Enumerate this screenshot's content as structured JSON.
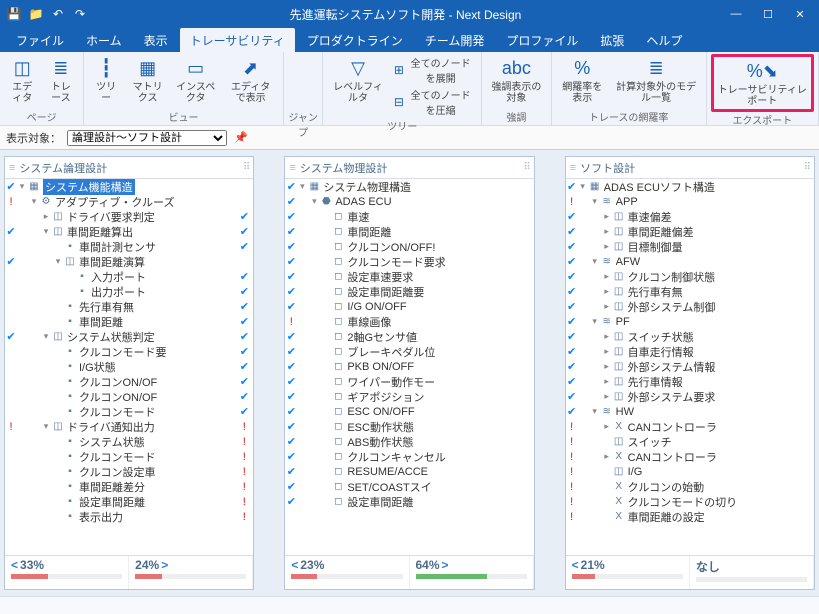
{
  "title": "先進運転システムソフト開発 - Next Design",
  "menu": [
    "ファイル",
    "ホーム",
    "表示",
    "トレーサビリティ",
    "プロダクトライン",
    "チーム開発",
    "プロファイル",
    "拡張",
    "ヘルプ"
  ],
  "menu_active": 3,
  "ribbon": {
    "groups": [
      {
        "label": "ページ",
        "items": [
          {
            "icon": "◫",
            "label": "エディタ"
          },
          {
            "icon": "≣",
            "label": "トレース"
          }
        ]
      },
      {
        "label": "ビュー",
        "items": [
          {
            "icon": "┇",
            "label": "ツリー"
          },
          {
            "icon": "▦",
            "label": "マトリクス"
          },
          {
            "icon": "▭",
            "label": "インスペクタ"
          },
          {
            "icon": "⬈",
            "label": "エディタで表示"
          }
        ]
      },
      {
        "label": "ジャンプ",
        "items": []
      },
      {
        "label": "ツリー",
        "items": [
          {
            "icon": "▽",
            "label": "レベルフィルタ"
          }
        ],
        "side": [
          {
            "icon": "⊞",
            "label": "全てのノードを展開"
          },
          {
            "icon": "⊟",
            "label": "全てのノードを圧縮"
          }
        ]
      },
      {
        "label": "強調",
        "items": [
          {
            "icon": "abc",
            "label": "強調表示の対象"
          }
        ]
      },
      {
        "label": "トレースの網羅率",
        "items": [
          {
            "icon": "%",
            "label": "網羅率を表示"
          },
          {
            "icon": "≣",
            "label": "計算対象外のモデル一覧"
          }
        ]
      },
      {
        "label": "エクスポート",
        "items": [
          {
            "icon": "%⬊",
            "label": "トレーサビリティレポート",
            "hl": true
          }
        ]
      }
    ]
  },
  "filter": {
    "label": "表示対象：",
    "value": "論理設計～ソフト設計"
  },
  "panes": [
    {
      "title": "システム論理設計",
      "coverage": [
        {
          "arrowL": "<",
          "pct": "33%",
          "fill": 33,
          "color": "red"
        },
        {
          "pct": "24%",
          "arrowR": ">",
          "fill": 24,
          "color": "red"
        }
      ],
      "nodes": [
        {
          "ind": 0,
          "m": "b",
          "t": "▾",
          "i": "▦",
          "l": "システム機能構造",
          "sel": true
        },
        {
          "ind": 1,
          "m": "r",
          "t": "▾",
          "i": "⚙",
          "l": "アダプティブ・クルーズ"
        },
        {
          "ind": 2,
          "t": "▸",
          "i": "◫",
          "l": "ドライバ要求判定",
          "r": "b"
        },
        {
          "ind": 2,
          "m": "b",
          "t": "▾",
          "i": "◫",
          "l": "車間距離算出",
          "r": "b"
        },
        {
          "ind": 3,
          "i": "▪",
          "l": "車間計測センサ",
          "r": "b"
        },
        {
          "ind": 3,
          "m": "b",
          "t": "▾",
          "i": "◫",
          "l": "車間距離演算"
        },
        {
          "ind": 4,
          "i": "▪",
          "l": "入力ポート",
          "r": "b"
        },
        {
          "ind": 4,
          "i": "▪",
          "l": "出力ポート",
          "r": "b"
        },
        {
          "ind": 3,
          "i": "▪",
          "l": "先行車有無",
          "r": "b"
        },
        {
          "ind": 3,
          "i": "▪",
          "l": "車間距離",
          "r": "b"
        },
        {
          "ind": 2,
          "m": "b",
          "t": "▾",
          "i": "◫",
          "l": "システム状態判定",
          "r": "b"
        },
        {
          "ind": 3,
          "i": "▪",
          "l": "クルコンモード要",
          "r": "b"
        },
        {
          "ind": 3,
          "i": "▪",
          "l": "I/G状態",
          "r": "b"
        },
        {
          "ind": 3,
          "i": "▪",
          "l": "クルコンON/OF",
          "r": "b"
        },
        {
          "ind": 3,
          "i": "▪",
          "l": "クルコンON/OF",
          "r": "b"
        },
        {
          "ind": 3,
          "i": "▪",
          "l": "クルコンモード",
          "r": "b"
        },
        {
          "ind": 2,
          "m": "r",
          "t": "▾",
          "i": "◫",
          "l": "ドライバ通知出力",
          "r": "r"
        },
        {
          "ind": 3,
          "i": "▪",
          "l": "システム状態",
          "r": "r"
        },
        {
          "ind": 3,
          "i": "▪",
          "l": "クルコンモード",
          "r": "r"
        },
        {
          "ind": 3,
          "i": "▪",
          "l": "クルコン設定車",
          "r": "r"
        },
        {
          "ind": 3,
          "i": "▪",
          "l": "車間距離差分",
          "r": "r"
        },
        {
          "ind": 3,
          "i": "▪",
          "l": "設定車間距離",
          "r": "r"
        },
        {
          "ind": 3,
          "i": "▪",
          "l": "表示出力",
          "r": "r"
        }
      ]
    },
    {
      "title": "システム物理設計",
      "coverage": [
        {
          "arrowL": "<",
          "pct": "23%",
          "fill": 23,
          "color": "red"
        },
        {
          "pct": "64%",
          "arrowR": ">",
          "fill": 64,
          "color": "green"
        }
      ],
      "nodes": [
        {
          "ind": 0,
          "m": "b",
          "t": "▾",
          "i": "▦",
          "l": "システム物理構造"
        },
        {
          "ind": 1,
          "m": "b",
          "t": "▾",
          "i": "⬣",
          "l": "ADAS ECU"
        },
        {
          "ind": 2,
          "m": "b",
          "i": "◻",
          "l": "車速"
        },
        {
          "ind": 2,
          "m": "b",
          "i": "◻",
          "l": "車間距離"
        },
        {
          "ind": 2,
          "m": "b",
          "i": "◻",
          "l": "クルコンON/OFF!"
        },
        {
          "ind": 2,
          "m": "b",
          "i": "◻",
          "l": "クルコンモード要求"
        },
        {
          "ind": 2,
          "m": "b",
          "i": "◻",
          "l": "設定車速要求"
        },
        {
          "ind": 2,
          "m": "b",
          "i": "◻",
          "l": "設定車間距離要"
        },
        {
          "ind": 2,
          "m": "b",
          "i": "◻",
          "l": "I/G ON/OFF"
        },
        {
          "ind": 2,
          "m": "r",
          "i": "◻",
          "l": "車線画像"
        },
        {
          "ind": 2,
          "m": "b",
          "i": "◻",
          "l": "2軸Gセンサ値"
        },
        {
          "ind": 2,
          "m": "b",
          "i": "◻",
          "l": "ブレーキペダル位"
        },
        {
          "ind": 2,
          "m": "b",
          "i": "◻",
          "l": "PKB ON/OFF"
        },
        {
          "ind": 2,
          "m": "b",
          "i": "◻",
          "l": "ワイパー動作モー"
        },
        {
          "ind": 2,
          "m": "b",
          "i": "◻",
          "l": "ギアポジション"
        },
        {
          "ind": 2,
          "m": "b",
          "i": "◻",
          "l": "ESC ON/OFF"
        },
        {
          "ind": 2,
          "m": "b",
          "i": "◻",
          "l": "ESC動作状態"
        },
        {
          "ind": 2,
          "m": "b",
          "i": "◻",
          "l": "ABS動作状態"
        },
        {
          "ind": 2,
          "m": "b",
          "i": "◻",
          "l": "クルコンキャンセル"
        },
        {
          "ind": 2,
          "m": "b",
          "i": "◻",
          "l": "RESUME/ACCE"
        },
        {
          "ind": 2,
          "m": "b",
          "i": "◻",
          "l": "SET/COASTスイ"
        },
        {
          "ind": 2,
          "m": "b",
          "i": "◻",
          "l": "設定車間距離"
        }
      ]
    },
    {
      "title": "ソフト設計",
      "coverage": [
        {
          "arrowL": "<",
          "pct": "21%",
          "fill": 21,
          "color": "red"
        },
        {
          "pct": "なし",
          "fill": 0
        }
      ],
      "nodes": [
        {
          "ind": 0,
          "m": "b",
          "t": "▾",
          "i": "▦",
          "l": "ADAS ECUソフト構造"
        },
        {
          "ind": 1,
          "m": "r",
          "t": "▾",
          "i": "≋",
          "l": "APP"
        },
        {
          "ind": 2,
          "m": "b",
          "t": "▸",
          "i": "◫",
          "l": "車速偏差"
        },
        {
          "ind": 2,
          "m": "b",
          "t": "▸",
          "i": "◫",
          "l": "車間距離偏差"
        },
        {
          "ind": 2,
          "m": "b",
          "t": "▸",
          "i": "◫",
          "l": "目標制御量"
        },
        {
          "ind": 1,
          "m": "b",
          "t": "▾",
          "i": "≋",
          "l": "AFW"
        },
        {
          "ind": 2,
          "m": "b",
          "t": "▸",
          "i": "◫",
          "l": "クルコン制御状態"
        },
        {
          "ind": 2,
          "m": "b",
          "t": "▸",
          "i": "◫",
          "l": "先行車有無"
        },
        {
          "ind": 2,
          "m": "b",
          "t": "▸",
          "i": "◫",
          "l": "外部システム制御"
        },
        {
          "ind": 1,
          "m": "b",
          "t": "▾",
          "i": "≋",
          "l": "PF"
        },
        {
          "ind": 2,
          "m": "b",
          "t": "▸",
          "i": "◫",
          "l": "スイッチ状態"
        },
        {
          "ind": 2,
          "m": "b",
          "t": "▸",
          "i": "◫",
          "l": "自車走行情報"
        },
        {
          "ind": 2,
          "m": "b",
          "t": "▸",
          "i": "◫",
          "l": "外部システム情報"
        },
        {
          "ind": 2,
          "m": "b",
          "t": "▸",
          "i": "◫",
          "l": "先行車情報"
        },
        {
          "ind": 2,
          "m": "b",
          "t": "▸",
          "i": "◫",
          "l": "外部システム要求"
        },
        {
          "ind": 1,
          "m": "b",
          "t": "▾",
          "i": "≋",
          "l": "HW"
        },
        {
          "ind": 2,
          "m": "r",
          "t": "▸",
          "i": "X",
          "l": "CANコントローラ"
        },
        {
          "ind": 2,
          "m": "r",
          "i": "◫",
          "l": "スイッチ"
        },
        {
          "ind": 2,
          "m": "r",
          "t": "▸",
          "i": "X",
          "l": "CANコントローラ"
        },
        {
          "ind": 2,
          "m": "r",
          "i": "◫",
          "l": "I/G"
        },
        {
          "ind": 2,
          "m": "r",
          "i": "X",
          "l": "クルコンの始動"
        },
        {
          "ind": 2,
          "m": "r",
          "i": "X",
          "l": "クルコンモードの切り"
        },
        {
          "ind": 2,
          "m": "r",
          "i": "X",
          "l": "車間距離の設定"
        }
      ]
    }
  ]
}
